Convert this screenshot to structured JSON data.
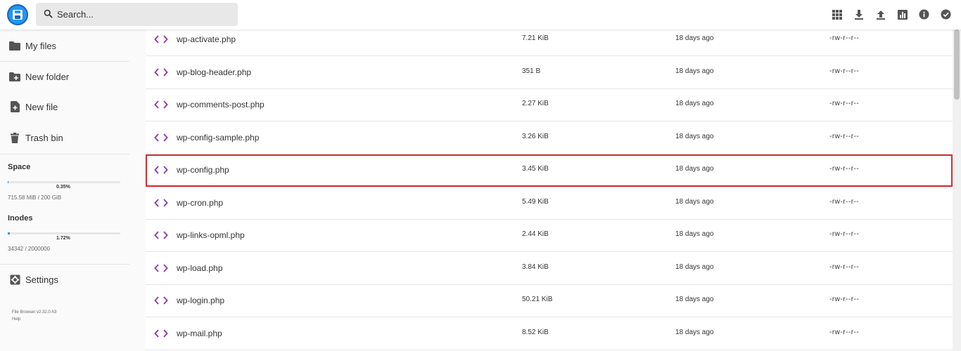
{
  "header": {
    "search_placeholder": "Search...",
    "actions": [
      "grid-view-icon",
      "download-icon",
      "upload-icon",
      "info-chart-icon",
      "info-icon",
      "select-check-icon"
    ]
  },
  "sidebar": {
    "items": [
      {
        "label": "My files",
        "icon": "folder-icon"
      },
      {
        "label": "New folder",
        "icon": "new-folder-icon"
      },
      {
        "label": "New file",
        "icon": "new-file-icon"
      },
      {
        "label": "Trash bin",
        "icon": "trash-icon"
      }
    ],
    "space": {
      "title": "Space",
      "percent_label": "0.35%",
      "percent": 0.35,
      "value": "715.58 MiB / 200 GiB"
    },
    "inodes": {
      "title": "Inodes",
      "percent_label": "1.72%",
      "percent": 1.72,
      "value": "34342 / 2000000"
    },
    "settings_label": "Settings",
    "version": "File Browser v2.32.0-h3",
    "help": "Help"
  },
  "files": [
    {
      "name": "wp-activate.php",
      "size": "7.21 KiB",
      "modified": "18 days ago",
      "perms": "-rw-r--r--"
    },
    {
      "name": "wp-blog-header.php",
      "size": "351 B",
      "modified": "18 days ago",
      "perms": "-rw-r--r--"
    },
    {
      "name": "wp-comments-post.php",
      "size": "2.27 KiB",
      "modified": "18 days ago",
      "perms": "-rw-r--r--"
    },
    {
      "name": "wp-config-sample.php",
      "size": "3.26 KiB",
      "modified": "18 days ago",
      "perms": "-rw-r--r--"
    },
    {
      "name": "wp-config.php",
      "size": "3.45 KiB",
      "modified": "18 days ago",
      "perms": "-rw-r--r--",
      "selected": true
    },
    {
      "name": "wp-cron.php",
      "size": "5.49 KiB",
      "modified": "18 days ago",
      "perms": "-rw-r--r--"
    },
    {
      "name": "wp-links-opml.php",
      "size": "2.44 KiB",
      "modified": "18 days ago",
      "perms": "-rw-r--r--"
    },
    {
      "name": "wp-load.php",
      "size": "3.84 KiB",
      "modified": "18 days ago",
      "perms": "-rw-r--r--"
    },
    {
      "name": "wp-login.php",
      "size": "50.21 KiB",
      "modified": "18 days ago",
      "perms": "-rw-r--r--"
    },
    {
      "name": "wp-mail.php",
      "size": "8.52 KiB",
      "modified": "18 days ago",
      "perms": "-rw-r--r--"
    }
  ],
  "colors": {
    "accent": "#2196f3",
    "file_icon": "#8e44ad",
    "selection_border": "#d32f2f"
  }
}
